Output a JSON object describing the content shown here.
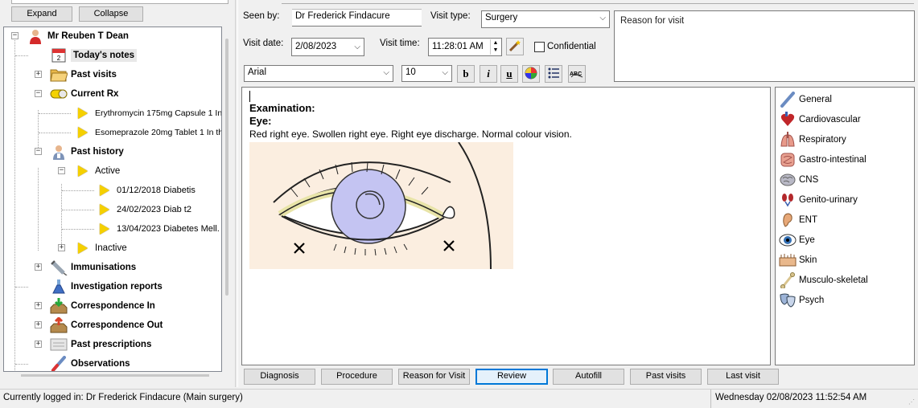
{
  "tree_toolbar": {
    "expand_label": "Expand",
    "collapse_label": "Collapse"
  },
  "tree": {
    "patient": "Mr Reuben T Dean",
    "todays_notes": "Today's notes",
    "past_visits": "Past visits",
    "current_rx": "Current Rx",
    "rx_items": [
      "Erythromycin 175mg Capsule 1 In",
      "Esomeprazole 20mg Tablet 1 In th"
    ],
    "past_history": "Past history",
    "active": "Active",
    "active_items": [
      "01/12/2018  Diabetis",
      "24/02/2023  Diab t2",
      "13/04/2023  Diabetes Mell."
    ],
    "inactive": "Inactive",
    "immunisations": "Immunisations",
    "investigation_reports": "Investigation reports",
    "correspondence_in": "Correspondence In",
    "correspondence_out": "Correspondence Out",
    "past_prescriptions": "Past prescriptions",
    "observations": "Observations"
  },
  "form": {
    "seen_by_label": "Seen by:",
    "seen_by_value": "Dr Frederick Findacure",
    "visit_type_label": "Visit type:",
    "visit_type_value": "Surgery",
    "visit_date_label": "Visit date:",
    "visit_date_value": "2/08/2023",
    "visit_time_label": "Visit time:",
    "visit_time_value": "11:28:01 AM",
    "confidential_label": "Confidential",
    "reason_placeholder": "Reason for visit",
    "font_value": "Arial",
    "size_value": "10"
  },
  "notes": {
    "heading1": "Examination:",
    "heading2": "Eye:",
    "body": "Red right eye. Swollen right  eye. Right eye discharge. Normal colour vision."
  },
  "systems": [
    "General",
    "Cardiovascular",
    "Respiratory",
    "Gastro-intestinal",
    "CNS",
    "Genito-urinary",
    "ENT",
    "Eye",
    "Skin",
    "Musculo-skeletal",
    "Psych"
  ],
  "bottom_buttons": {
    "diagnosis": "Diagnosis",
    "procedure": "Procedure",
    "reason": "Reason for Visit",
    "review": "Review",
    "autofill": "Autofill",
    "past_visits": "Past visits",
    "last_visit": "Last visit"
  },
  "status": {
    "logged_in": "Currently logged in:  Dr Frederick Findacure (Main surgery)",
    "datetime": "Wednesday 02/08/2023 11:52:54 AM"
  }
}
